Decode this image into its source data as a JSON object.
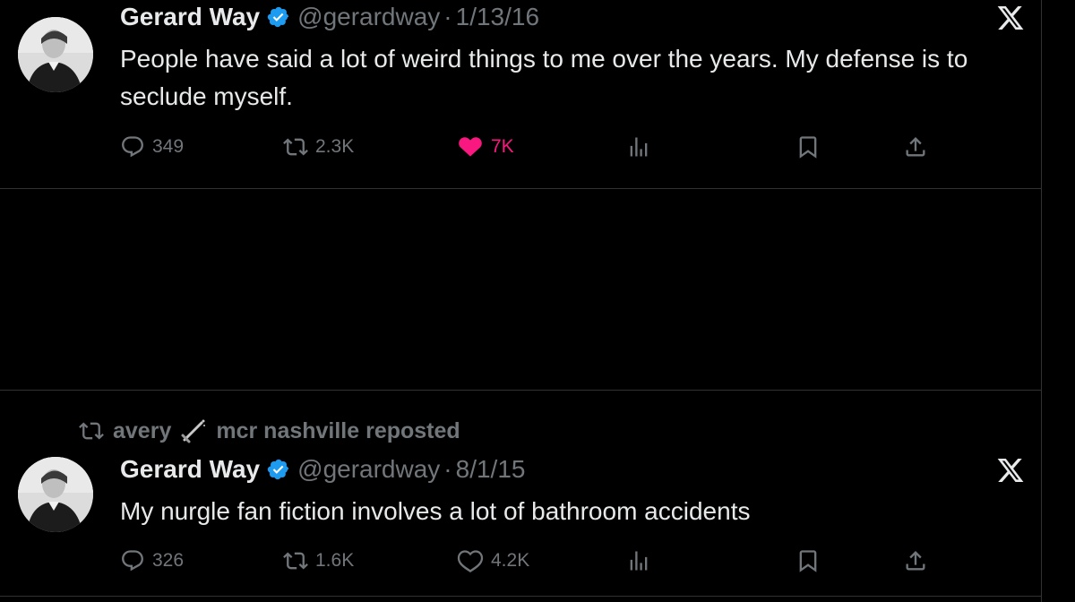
{
  "tweets": [
    {
      "author_name": "Gerard Way",
      "handle": "@gerardway",
      "separator": "·",
      "date": "1/13/16",
      "text": "People have said a lot of weird things to me over the years. My defense is to seclude myself.",
      "replies": "349",
      "reposts": "2.3K",
      "likes": "7K",
      "liked": true
    },
    {
      "repost_context": "avery",
      "repost_context_suffix": "mcr nashville reposted",
      "author_name": "Gerard Way",
      "handle": "@gerardway",
      "separator": "·",
      "date": "8/1/15",
      "text": "My nurgle fan fiction involves a lot of bathroom accidents",
      "replies": "326",
      "reposts": "1.6K",
      "likes": "4.2K",
      "liked": false
    }
  ],
  "icons": {
    "verified": "verified-badge-icon",
    "platform": "x-logo-icon",
    "reply": "reply-icon",
    "repost": "repost-icon",
    "like": "heart-icon",
    "views": "views-icon",
    "bookmark": "bookmark-icon",
    "share": "share-icon",
    "emoji": "dagger-icon"
  },
  "colors": {
    "background": "#000000",
    "text": "#e7e9ea",
    "muted": "#71767b",
    "like_active": "#f91880",
    "verified": "#1d9bf0",
    "border": "#2f3336"
  }
}
